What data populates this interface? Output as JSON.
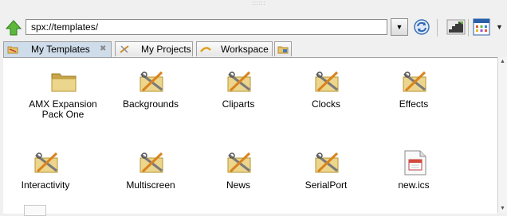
{
  "toolbar": {
    "url": "spx://templates/"
  },
  "tabs": [
    {
      "label": "My Templates",
      "icon": "template-folder-icon",
      "active": true
    },
    {
      "label": "My Projects",
      "icon": "projects-icon",
      "active": false
    },
    {
      "label": "Workspace",
      "icon": "workspace-icon",
      "active": false
    }
  ],
  "items": [
    {
      "label": "AMX Expansion Pack One",
      "icon": "folder-icon"
    },
    {
      "label": "Backgrounds",
      "icon": "tools-folder-icon"
    },
    {
      "label": "Cliparts",
      "icon": "tools-folder-icon"
    },
    {
      "label": "Clocks",
      "icon": "tools-folder-icon"
    },
    {
      "label": "Effects",
      "icon": "tools-folder-icon"
    },
    {
      "label": "Interactivity",
      "icon": "tools-folder-icon"
    },
    {
      "label": "Multiscreen",
      "icon": "tools-folder-icon"
    },
    {
      "label": "News",
      "icon": "tools-folder-icon"
    },
    {
      "label": "SerialPort",
      "icon": "tools-folder-icon"
    },
    {
      "label": "new.ics",
      "icon": "calendar-file-icon"
    }
  ]
}
